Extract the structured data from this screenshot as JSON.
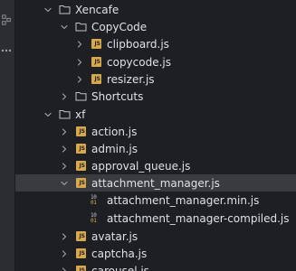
{
  "tree": [
    {
      "label": "Xencafe",
      "type": "folder",
      "expanded": true,
      "depth": 0
    },
    {
      "label": "CopyCode",
      "type": "folder",
      "expanded": true,
      "depth": 1
    },
    {
      "label": "clipboard.js",
      "type": "js",
      "expanded": false,
      "depth": 2
    },
    {
      "label": "copycode.js",
      "type": "js",
      "expanded": false,
      "depth": 2
    },
    {
      "label": "resizer.js",
      "type": "js",
      "expanded": false,
      "depth": 2
    },
    {
      "label": "Shortcuts",
      "type": "folder",
      "expanded": false,
      "depth": 1
    },
    {
      "label": "xf",
      "type": "folder",
      "expanded": true,
      "depth": 0
    },
    {
      "label": "action.js",
      "type": "js",
      "expanded": false,
      "depth": 1
    },
    {
      "label": "admin.js",
      "type": "js",
      "expanded": false,
      "depth": 1
    },
    {
      "label": "approval_queue.js",
      "type": "js",
      "expanded": false,
      "depth": 1
    },
    {
      "label": "attachment_manager.js",
      "type": "js",
      "expanded": true,
      "depth": 1,
      "selected": true
    },
    {
      "label": "attachment_manager.min.js",
      "type": "bin",
      "depth": 2
    },
    {
      "label": "attachment_manager-compiled.js",
      "type": "bin",
      "depth": 2
    },
    {
      "label": "avatar.js",
      "type": "js",
      "expanded": false,
      "depth": 1
    },
    {
      "label": "captcha.js",
      "type": "js",
      "expanded": false,
      "depth": 1
    },
    {
      "label": "carousel.js",
      "type": "js",
      "expanded": false,
      "depth": 1
    }
  ],
  "icons": {
    "folder": "folder-icon",
    "js": "javascript-file-icon",
    "bin": "binary-file-icon"
  },
  "colors": {
    "background": "#1e1f22",
    "selected_row": "#393b40",
    "js_icon": "#d7a94b",
    "text": "#dfe1e5",
    "chevron": "#9da0a6"
  }
}
